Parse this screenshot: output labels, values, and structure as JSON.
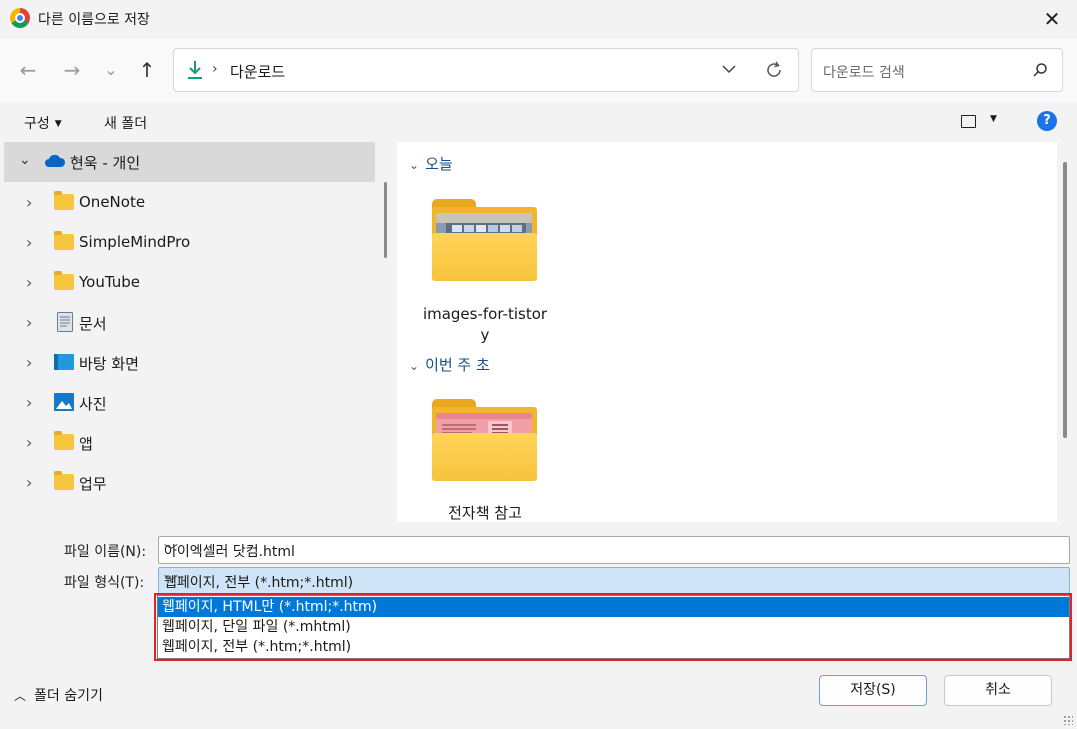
{
  "window": {
    "title": "다른 이름으로 저장",
    "app_icon": "chrome-icon",
    "close_label": "✕"
  },
  "nav": {
    "back_icon": "←",
    "forward_icon": "→",
    "recent_icon": "⌄",
    "up_icon": "↑",
    "breadcrumb_sep": "›",
    "current_location": "다운로드",
    "search_placeholder": "다운로드 검색"
  },
  "toolbar": {
    "organize_label": "구성",
    "new_folder_label": "새 폴더",
    "help_label": "?"
  },
  "tree": {
    "root_label": "현욱 - 개인",
    "items": [
      {
        "label": "OneNote",
        "icon": "folder-icon"
      },
      {
        "label": "SimpleMindPro",
        "icon": "folder-icon"
      },
      {
        "label": "YouTube",
        "icon": "folder-icon"
      },
      {
        "label": "문서",
        "icon": "documents-icon"
      },
      {
        "label": "바탕 화면",
        "icon": "desktop-icon"
      },
      {
        "label": "사진",
        "icon": "pictures-icon"
      },
      {
        "label": "앱",
        "icon": "folder-icon"
      },
      {
        "label": "업무",
        "icon": "folder-icon"
      }
    ]
  },
  "content": {
    "groups": [
      {
        "header": "오늘",
        "items": [
          {
            "label_line1": "images-for-tistor",
            "label_line2": "y"
          }
        ]
      },
      {
        "header": "이번 주 초",
        "items": [
          {
            "label_line1": "전자책 참고",
            "label_line2": ""
          }
        ]
      }
    ]
  },
  "form": {
    "filename_label": "파일 이름(N):",
    "filename_value": "아이엑셀러 닷컴.html",
    "filetype_label": "파일 형식(T):",
    "filetype_value": "웹페이지, 전부 (*.htm;*.html)",
    "filetype_options": [
      "웹페이지, HTML만 (*.html;*.htm)",
      "웹페이지, 단일 파일 (*.mhtml)",
      "웹페이지, 전부 (*.htm;*.html)"
    ],
    "highlighted_option_index": 0
  },
  "footer": {
    "hide_folders_label": "폴더 숨기기",
    "save_label": "저장(S)",
    "cancel_label": "취소"
  },
  "colors": {
    "accent": "#0078d7",
    "highlight_box": "#e0222c",
    "select_bg": "#cfe4f7"
  }
}
